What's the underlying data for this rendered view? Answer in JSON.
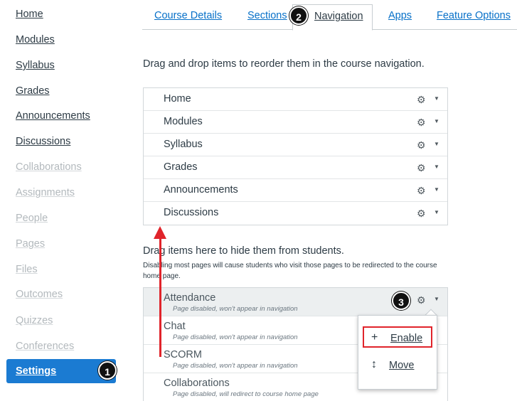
{
  "sidebar": {
    "items": [
      {
        "label": "Home",
        "state": "enabled"
      },
      {
        "label": "Modules",
        "state": "enabled"
      },
      {
        "label": "Syllabus",
        "state": "enabled"
      },
      {
        "label": "Grades",
        "state": "enabled"
      },
      {
        "label": "Announcements",
        "state": "enabled"
      },
      {
        "label": "Discussions",
        "state": "enabled"
      },
      {
        "label": "Collaborations",
        "state": "disabled"
      },
      {
        "label": "Assignments",
        "state": "disabled"
      },
      {
        "label": "People",
        "state": "disabled"
      },
      {
        "label": "Pages",
        "state": "disabled"
      },
      {
        "label": "Files",
        "state": "disabled"
      },
      {
        "label": "Outcomes",
        "state": "disabled"
      },
      {
        "label": "Quizzes",
        "state": "disabled"
      },
      {
        "label": "Conferences",
        "state": "disabled"
      }
    ],
    "active_item": "Settings"
  },
  "tabs": [
    {
      "label": "Course Details"
    },
    {
      "label": "Sections"
    },
    {
      "label": "Navigation",
      "active": true
    },
    {
      "label": "Apps"
    },
    {
      "label": "Feature Options"
    }
  ],
  "navigation": {
    "instruction": "Drag and drop items to reorder them in the course navigation.",
    "enabled_items": [
      "Home",
      "Modules",
      "Syllabus",
      "Grades",
      "Announcements",
      "Discussions"
    ],
    "hide_title": "Drag items here to hide them from students.",
    "hide_note": "Disabling most pages will cause students who visit those pages to be redirected to the course home page.",
    "disabled_items": [
      {
        "name": "Attendance",
        "note": "Page disabled, won't appear in navigation"
      },
      {
        "name": "Chat",
        "note": "Page disabled, won't appear in navigation"
      },
      {
        "name": "SCORM",
        "note": "Page disabled, won't appear in navigation"
      },
      {
        "name": "Collaborations",
        "note": "Page disabled, will redirect to course home page"
      }
    ]
  },
  "dropdown": {
    "enable_label": "Enable",
    "move_label": "Move"
  },
  "badges": {
    "one": "1",
    "two": "2",
    "three": "3"
  },
  "icons": {
    "gear": "gear-icon",
    "caret": "caret-down-icon",
    "plus": "plus-icon",
    "move": "move-icon"
  },
  "colors": {
    "accent": "#1b7bd2",
    "link": "#0770c8",
    "callout": "#e0242b"
  }
}
